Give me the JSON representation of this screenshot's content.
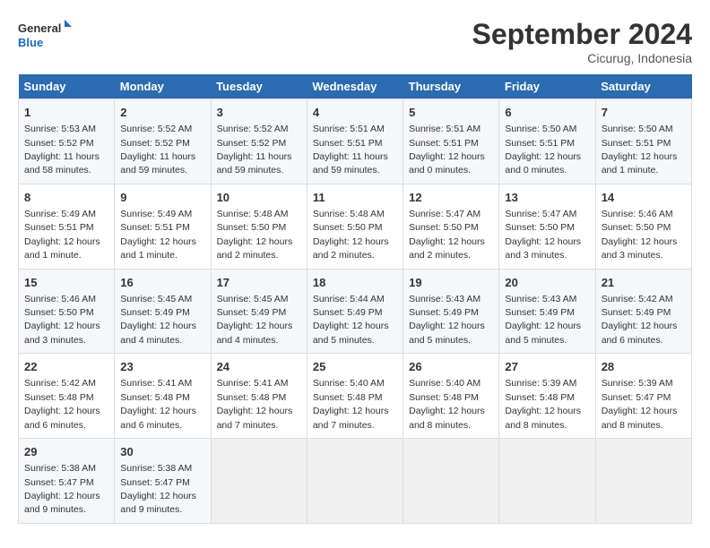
{
  "header": {
    "logo_line1": "General",
    "logo_line2": "Blue",
    "month": "September 2024",
    "location": "Cicurug, Indonesia"
  },
  "weekdays": [
    "Sunday",
    "Monday",
    "Tuesday",
    "Wednesday",
    "Thursday",
    "Friday",
    "Saturday"
  ],
  "weeks": [
    [
      {
        "day": "1",
        "info": "Sunrise: 5:53 AM\nSunset: 5:52 PM\nDaylight: 11 hours\nand 58 minutes."
      },
      {
        "day": "2",
        "info": "Sunrise: 5:52 AM\nSunset: 5:52 PM\nDaylight: 11 hours\nand 59 minutes."
      },
      {
        "day": "3",
        "info": "Sunrise: 5:52 AM\nSunset: 5:52 PM\nDaylight: 11 hours\nand 59 minutes."
      },
      {
        "day": "4",
        "info": "Sunrise: 5:51 AM\nSunset: 5:51 PM\nDaylight: 11 hours\nand 59 minutes."
      },
      {
        "day": "5",
        "info": "Sunrise: 5:51 AM\nSunset: 5:51 PM\nDaylight: 12 hours\nand 0 minutes."
      },
      {
        "day": "6",
        "info": "Sunrise: 5:50 AM\nSunset: 5:51 PM\nDaylight: 12 hours\nand 0 minutes."
      },
      {
        "day": "7",
        "info": "Sunrise: 5:50 AM\nSunset: 5:51 PM\nDaylight: 12 hours\nand 1 minute."
      }
    ],
    [
      {
        "day": "8",
        "info": "Sunrise: 5:49 AM\nSunset: 5:51 PM\nDaylight: 12 hours\nand 1 minute."
      },
      {
        "day": "9",
        "info": "Sunrise: 5:49 AM\nSunset: 5:51 PM\nDaylight: 12 hours\nand 1 minute."
      },
      {
        "day": "10",
        "info": "Sunrise: 5:48 AM\nSunset: 5:50 PM\nDaylight: 12 hours\nand 2 minutes."
      },
      {
        "day": "11",
        "info": "Sunrise: 5:48 AM\nSunset: 5:50 PM\nDaylight: 12 hours\nand 2 minutes."
      },
      {
        "day": "12",
        "info": "Sunrise: 5:47 AM\nSunset: 5:50 PM\nDaylight: 12 hours\nand 2 minutes."
      },
      {
        "day": "13",
        "info": "Sunrise: 5:47 AM\nSunset: 5:50 PM\nDaylight: 12 hours\nand 3 minutes."
      },
      {
        "day": "14",
        "info": "Sunrise: 5:46 AM\nSunset: 5:50 PM\nDaylight: 12 hours\nand 3 minutes."
      }
    ],
    [
      {
        "day": "15",
        "info": "Sunrise: 5:46 AM\nSunset: 5:50 PM\nDaylight: 12 hours\nand 3 minutes."
      },
      {
        "day": "16",
        "info": "Sunrise: 5:45 AM\nSunset: 5:49 PM\nDaylight: 12 hours\nand 4 minutes."
      },
      {
        "day": "17",
        "info": "Sunrise: 5:45 AM\nSunset: 5:49 PM\nDaylight: 12 hours\nand 4 minutes."
      },
      {
        "day": "18",
        "info": "Sunrise: 5:44 AM\nSunset: 5:49 PM\nDaylight: 12 hours\nand 5 minutes."
      },
      {
        "day": "19",
        "info": "Sunrise: 5:43 AM\nSunset: 5:49 PM\nDaylight: 12 hours\nand 5 minutes."
      },
      {
        "day": "20",
        "info": "Sunrise: 5:43 AM\nSunset: 5:49 PM\nDaylight: 12 hours\nand 5 minutes."
      },
      {
        "day": "21",
        "info": "Sunrise: 5:42 AM\nSunset: 5:49 PM\nDaylight: 12 hours\nand 6 minutes."
      }
    ],
    [
      {
        "day": "22",
        "info": "Sunrise: 5:42 AM\nSunset: 5:48 PM\nDaylight: 12 hours\nand 6 minutes."
      },
      {
        "day": "23",
        "info": "Sunrise: 5:41 AM\nSunset: 5:48 PM\nDaylight: 12 hours\nand 6 minutes."
      },
      {
        "day": "24",
        "info": "Sunrise: 5:41 AM\nSunset: 5:48 PM\nDaylight: 12 hours\nand 7 minutes."
      },
      {
        "day": "25",
        "info": "Sunrise: 5:40 AM\nSunset: 5:48 PM\nDaylight: 12 hours\nand 7 minutes."
      },
      {
        "day": "26",
        "info": "Sunrise: 5:40 AM\nSunset: 5:48 PM\nDaylight: 12 hours\nand 8 minutes."
      },
      {
        "day": "27",
        "info": "Sunrise: 5:39 AM\nSunset: 5:48 PM\nDaylight: 12 hours\nand 8 minutes."
      },
      {
        "day": "28",
        "info": "Sunrise: 5:39 AM\nSunset: 5:47 PM\nDaylight: 12 hours\nand 8 minutes."
      }
    ],
    [
      {
        "day": "29",
        "info": "Sunrise: 5:38 AM\nSunset: 5:47 PM\nDaylight: 12 hours\nand 9 minutes."
      },
      {
        "day": "30",
        "info": "Sunrise: 5:38 AM\nSunset: 5:47 PM\nDaylight: 12 hours\nand 9 minutes."
      },
      {
        "day": "",
        "info": ""
      },
      {
        "day": "",
        "info": ""
      },
      {
        "day": "",
        "info": ""
      },
      {
        "day": "",
        "info": ""
      },
      {
        "day": "",
        "info": ""
      }
    ]
  ]
}
